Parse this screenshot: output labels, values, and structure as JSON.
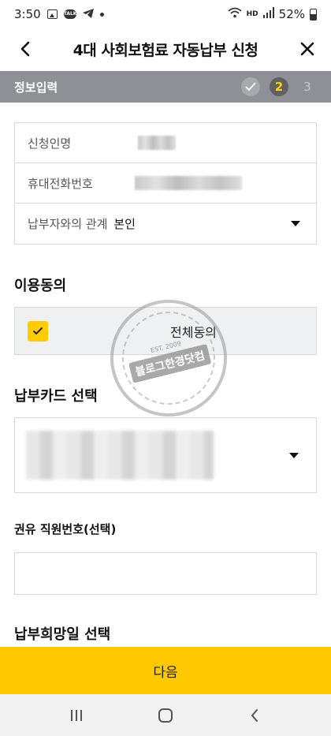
{
  "status_bar": {
    "time": "3:50",
    "network": "HD",
    "battery": "52%",
    "icons": [
      "image-icon",
      "talk-icon",
      "telegram-icon",
      "dot-icon",
      "wifi-icon",
      "signal-icon",
      "battery-icon"
    ]
  },
  "header": {
    "title": "4대 사회보험료 자동납부 신청",
    "back_icon": "chevron-left-icon",
    "close_icon": "close-icon"
  },
  "step_bar": {
    "label": "정보입력",
    "current_step": "2",
    "next_step": "3",
    "done_icon": "check-icon"
  },
  "info": {
    "applicant_label": "신청인명",
    "phone_label": "휴대전화번호",
    "relation_label": "납부자와의 관계",
    "relation_value": "본인"
  },
  "agreement": {
    "title": "이용동의",
    "all_agree_label": "전체동의",
    "checked": true
  },
  "card": {
    "title": "납부카드 선택"
  },
  "staff": {
    "title": "권유 직원번호(선택)",
    "value": ""
  },
  "payment_date": {
    "title": "납부희망일 선택"
  },
  "watermark": {
    "text": "블로그한경닷컴",
    "year": "EST. 2009"
  },
  "footer": {
    "next_label": "다음"
  },
  "nav": {
    "icons": [
      "recent-apps-icon",
      "home-icon",
      "back-icon"
    ]
  },
  "colors": {
    "accent": "#ffc800",
    "step_bar": "#8e9096",
    "step_current_text": "#ffd600"
  }
}
